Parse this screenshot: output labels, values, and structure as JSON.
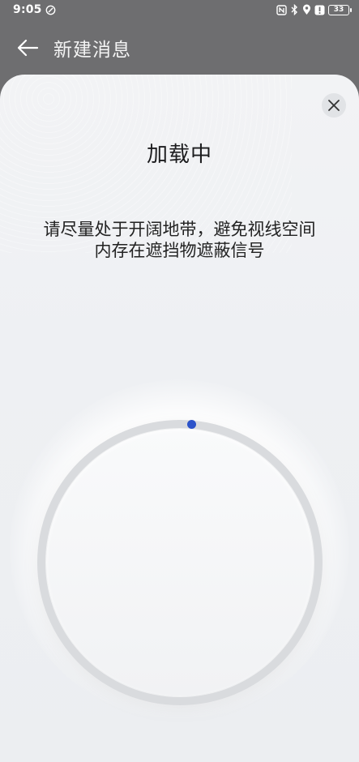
{
  "status_bar": {
    "time": "9:05",
    "battery": "33"
  },
  "header": {
    "title": "新建消息"
  },
  "sheet": {
    "title": "加载中",
    "hint_line1": "请尽量处于开阔地带，避免视线空间",
    "hint_line2": "内存在遮挡物遮蔽信号"
  },
  "icons": {
    "back": "arrow-left-icon",
    "close": "close-icon",
    "nfc": "nfc-icon",
    "bluetooth": "bluetooth-icon",
    "location": "location-icon",
    "alert": "alert-icon",
    "battery": "battery-icon"
  },
  "colors": {
    "header_bg": "#6e6e70",
    "sheet_bg": "#f0f1f4",
    "accent_dot": "#2c53c9"
  }
}
